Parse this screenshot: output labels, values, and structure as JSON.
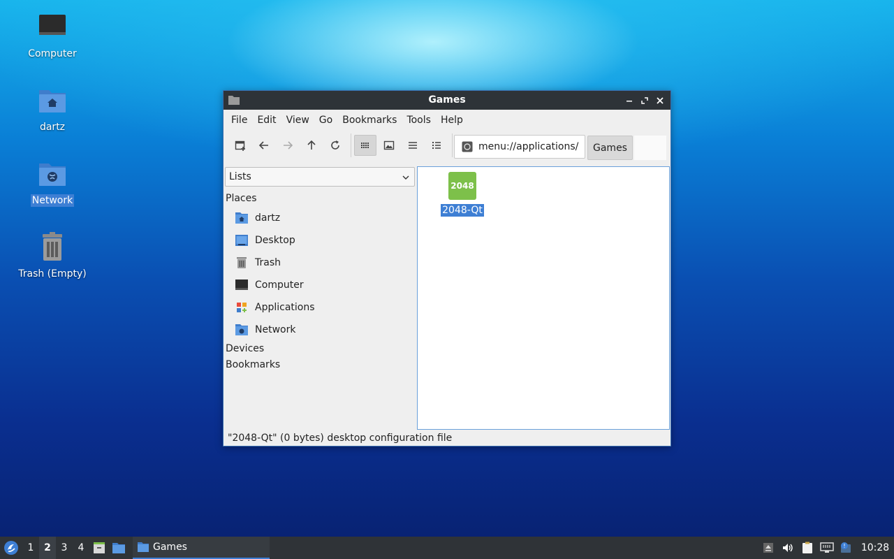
{
  "desktop": {
    "icons": [
      {
        "label": "Computer"
      },
      {
        "label": "dartz"
      },
      {
        "label": "Network"
      },
      {
        "label": "Trash (Empty)"
      }
    ]
  },
  "window": {
    "title": "Games",
    "menu": [
      "File",
      "Edit",
      "View",
      "Go",
      "Bookmarks",
      "Tools",
      "Help"
    ],
    "address": "menu://applications/",
    "breadcrumb": "Games",
    "sidebar": {
      "combo": "Lists",
      "places_header": "Places",
      "places": [
        {
          "label": "dartz",
          "icon": "home-folder-icon"
        },
        {
          "label": "Desktop",
          "icon": "desktop-icon"
        },
        {
          "label": "Trash",
          "icon": "trash-icon"
        },
        {
          "label": "Computer",
          "icon": "computer-icon"
        },
        {
          "label": "Applications",
          "icon": "applications-icon"
        },
        {
          "label": "Network",
          "icon": "network-icon"
        }
      ],
      "devices_header": "Devices",
      "bookmarks_header": "Bookmarks"
    },
    "files": [
      {
        "label": "2048-Qt",
        "icon_text": "2048"
      }
    ],
    "status": "\"2048-Qt\" (0 bytes) desktop configuration file"
  },
  "taskbar": {
    "workspaces": [
      "1",
      "2",
      "3",
      "4"
    ],
    "current_workspace": "2",
    "task": "Games",
    "clock": "10:28"
  },
  "colors": {
    "selection": "#3e7fd4",
    "titlebar": "#2e3338",
    "folder": "#4a8ad8",
    "app_icon": "#7dc04a"
  }
}
